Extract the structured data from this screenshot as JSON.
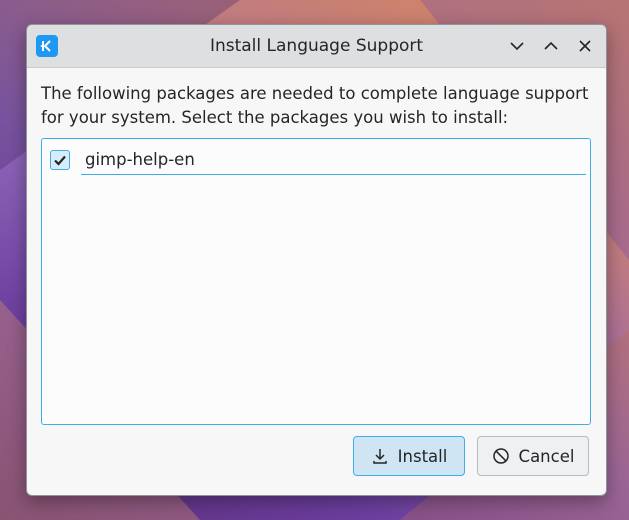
{
  "window": {
    "title": "Install Language Support"
  },
  "dialog": {
    "description": "The following packages are needed to complete language support for your system. Select the packages you wish to install:",
    "packages": [
      {
        "name": "gimp-help-en",
        "checked": true
      }
    ]
  },
  "buttons": {
    "install_label": "Install",
    "cancel_label": "Cancel"
  },
  "colors": {
    "accent": "#3daee9",
    "kde_blue": "#1d99f3"
  }
}
